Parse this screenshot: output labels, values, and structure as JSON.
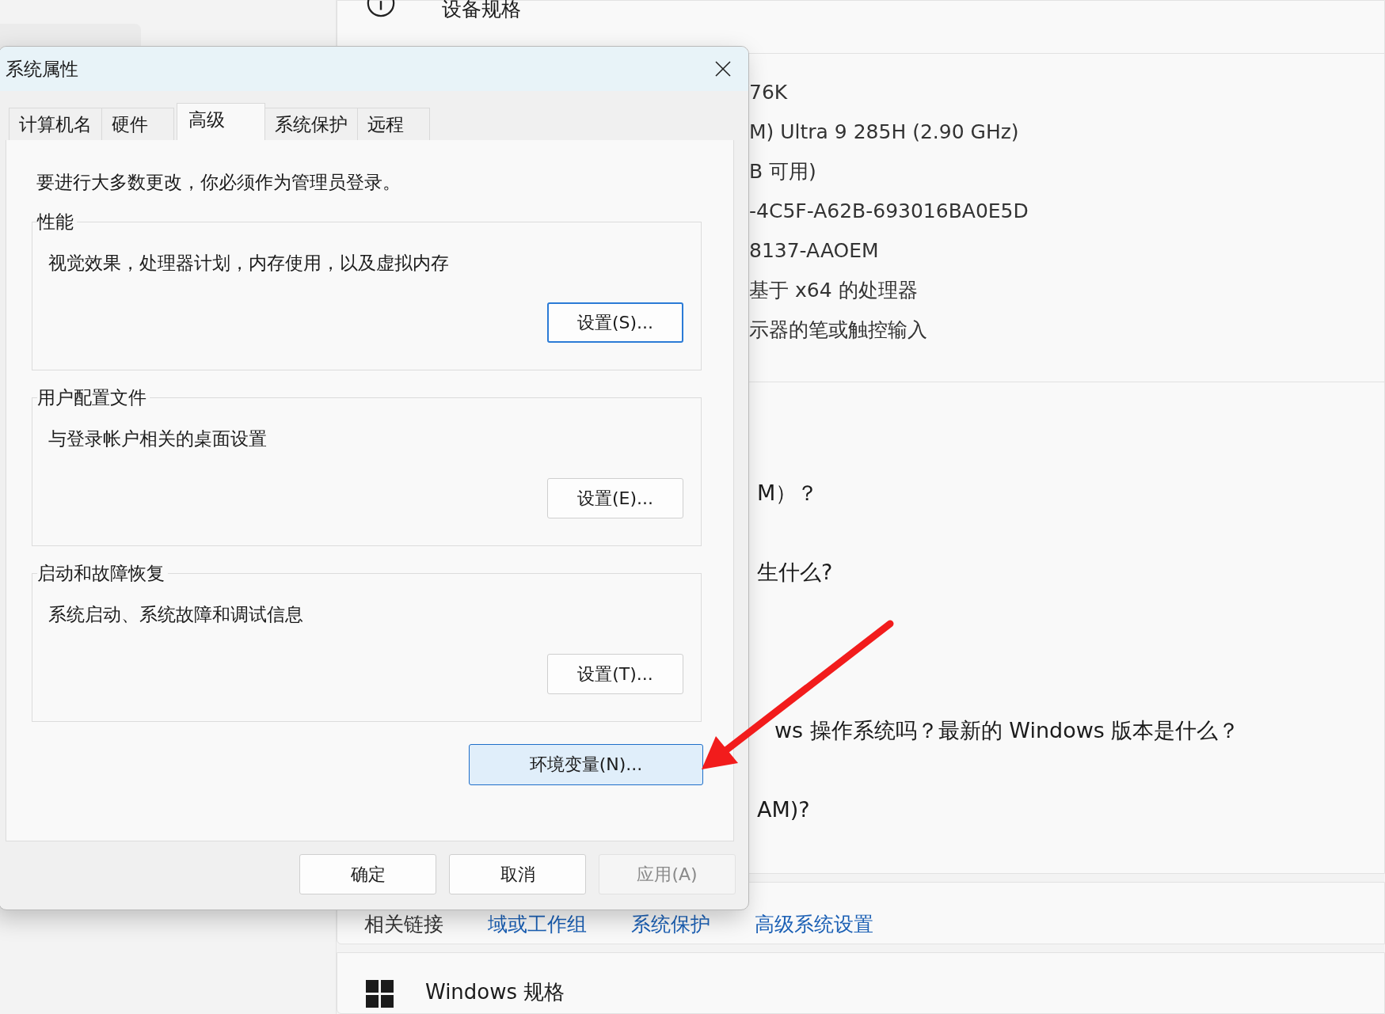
{
  "background": {
    "section_title": "设备规格",
    "specs": [
      "76K",
      "M) Ultra 9 285H (2.90 GHz)",
      "B 可用)",
      "-4C5F-A62B-693016BA0E5D",
      "8137-AAOEM",
      "基于 x64 的处理器",
      "示器的笔或触控输入"
    ],
    "faq": [
      "M）？",
      "生什么?",
      "ws 操作系统吗？最新的 Windows 版本是什么？",
      "AM)?"
    ],
    "related": {
      "label": "相关链接",
      "links": [
        "域或工作组",
        "系统保护",
        "高级系统设置"
      ]
    },
    "next_section": "Windows 规格"
  },
  "dialog": {
    "title": "系统属性",
    "tabs": [
      {
        "label": "计算机名",
        "selected": false
      },
      {
        "label": "硬件",
        "selected": false
      },
      {
        "label": "高级",
        "selected": true
      },
      {
        "label": "系统保护",
        "selected": false
      },
      {
        "label": "远程",
        "selected": false
      }
    ],
    "notice": "要进行大多数更改，你必须作为管理员登录。",
    "groups": [
      {
        "title": "性能",
        "description": "视觉效果，处理器计划，内存使用，以及虚拟内存",
        "button": "设置(S)...",
        "focused": true
      },
      {
        "title": "用户配置文件",
        "description": "与登录帐户相关的桌面设置",
        "button": "设置(E)...",
        "focused": false
      },
      {
        "title": "启动和故障恢复",
        "description": "系统启动、系统故障和调试信息",
        "button": "设置(T)...",
        "focused": false
      }
    ],
    "env_button": {
      "label": "环境变量(N)...",
      "hovered": true
    },
    "buttons": [
      {
        "label": "确定",
        "disabled": false
      },
      {
        "label": "取消",
        "disabled": false
      },
      {
        "label": "应用(A)",
        "disabled": true
      }
    ]
  }
}
